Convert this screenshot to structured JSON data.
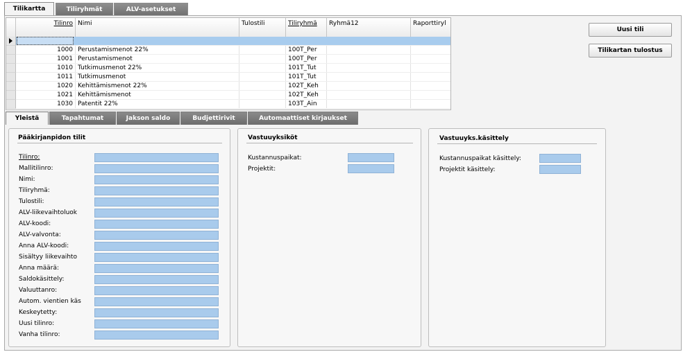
{
  "top_tabs": [
    "Tilikartta",
    "Tiliryhmät",
    "ALV-asetukset"
  ],
  "grid": {
    "columns": [
      "Tilinro",
      "Nimi",
      "Tulostili",
      "Tiliryhmä",
      "Ryhmä12",
      "Raporttiryl"
    ],
    "rows": [
      {
        "tilinro": "1000",
        "nimi": "Perustamismenot 22%",
        "tiliryhma": "100T_Per"
      },
      {
        "tilinro": "1001",
        "nimi": "Perustamismenot",
        "tiliryhma": "100T_Per"
      },
      {
        "tilinro": "1010",
        "nimi": "Tutkimusmenot 22%",
        "tiliryhma": "101T_Tut"
      },
      {
        "tilinro": "1011",
        "nimi": "Tutkimusmenot",
        "tiliryhma": "101T_Tut"
      },
      {
        "tilinro": "1020",
        "nimi": "Kehittämismenot 22%",
        "tiliryhma": "102T_Keh"
      },
      {
        "tilinro": "1021",
        "nimi": "Kehittämismenot",
        "tiliryhma": "102T_Keh"
      },
      {
        "tilinro": "1030",
        "nimi": "Patentit 22%",
        "tiliryhma": "103T_Ain"
      }
    ]
  },
  "buttons": {
    "new_account": "Uusi tili",
    "print_chart": "Tilikartan tulostus"
  },
  "bottom_tabs": [
    "Yleistä",
    "Tapahtumat",
    "Jakson saldo",
    "Budjettirivit",
    "Automaattiset kirjaukset"
  ],
  "panels": {
    "ledger": {
      "title": "Pääkirjanpidon tilit",
      "fields": [
        "Tilinro:",
        "Mallitilinro:",
        "Nimi:",
        "Tiliryhmä:",
        "Tulostili:",
        "ALV-liikevaihtoluok",
        "ALV-koodi:",
        "ALV-valvonta:",
        "Anna ALV-koodi:",
        "Sisältyy liikevaihto",
        "Anna määrä:",
        "Saldokäsittely:",
        "Valuuttanro:",
        "Autom. vientien käs",
        "Keskeytetty:",
        "Uusi tilinro:",
        "Vanha tilinro:"
      ]
    },
    "responsibility": {
      "title": "Vastuuyksiköt",
      "fields": [
        "Kustannuspaikat:",
        "Projektit:"
      ]
    },
    "responsibility_handling": {
      "title": "Vastuuyks.käsittely",
      "fields": [
        "Kustannuspaikat käsittely:",
        "Projektit käsittely:"
      ]
    }
  }
}
